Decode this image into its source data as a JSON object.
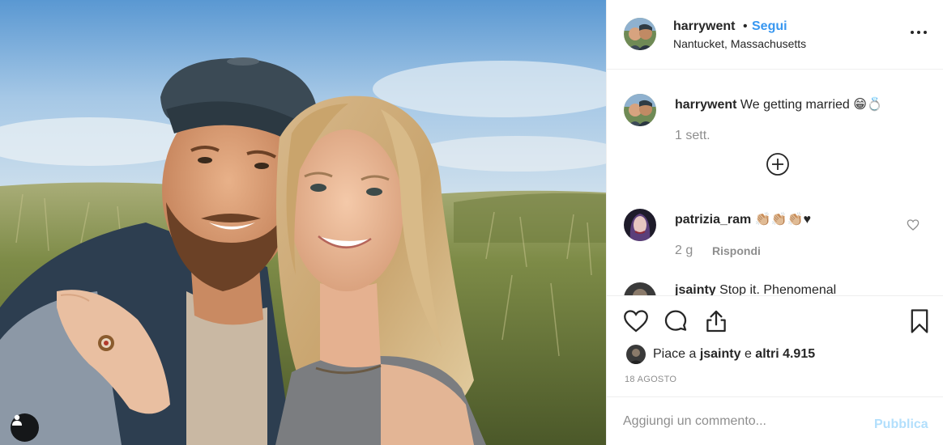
{
  "post": {
    "author": "harrywent",
    "separator": "•",
    "follow_label": "Segui",
    "location": "Nantucket, Massachusetts",
    "more_icon": "more-options-icon"
  },
  "comments": [
    {
      "username": "harrywent",
      "text": " We getting married 😁💍",
      "time": "1 sett."
    },
    {
      "username": "patrizia_ram",
      "text": " 👏🏼👏🏼👏🏼♥",
      "time": "2 g",
      "reply_label": "Rispondi"
    },
    {
      "username": "jsainty",
      "text": " Stop it. Phenomenal"
    }
  ],
  "likes": {
    "prefix": "Piace a ",
    "liker": "jsainty",
    "middle": " e ",
    "others": "altri 4.915"
  },
  "date": "18 AGOSTO",
  "add_comment": {
    "placeholder": "Aggiungi un commento...",
    "publish_label": "Pubblica"
  },
  "colors": {
    "link_blue": "#3897f0",
    "publish_disabled": "#b2dffc",
    "secondary_text": "#8e8e8e",
    "divider": "#efefef"
  }
}
